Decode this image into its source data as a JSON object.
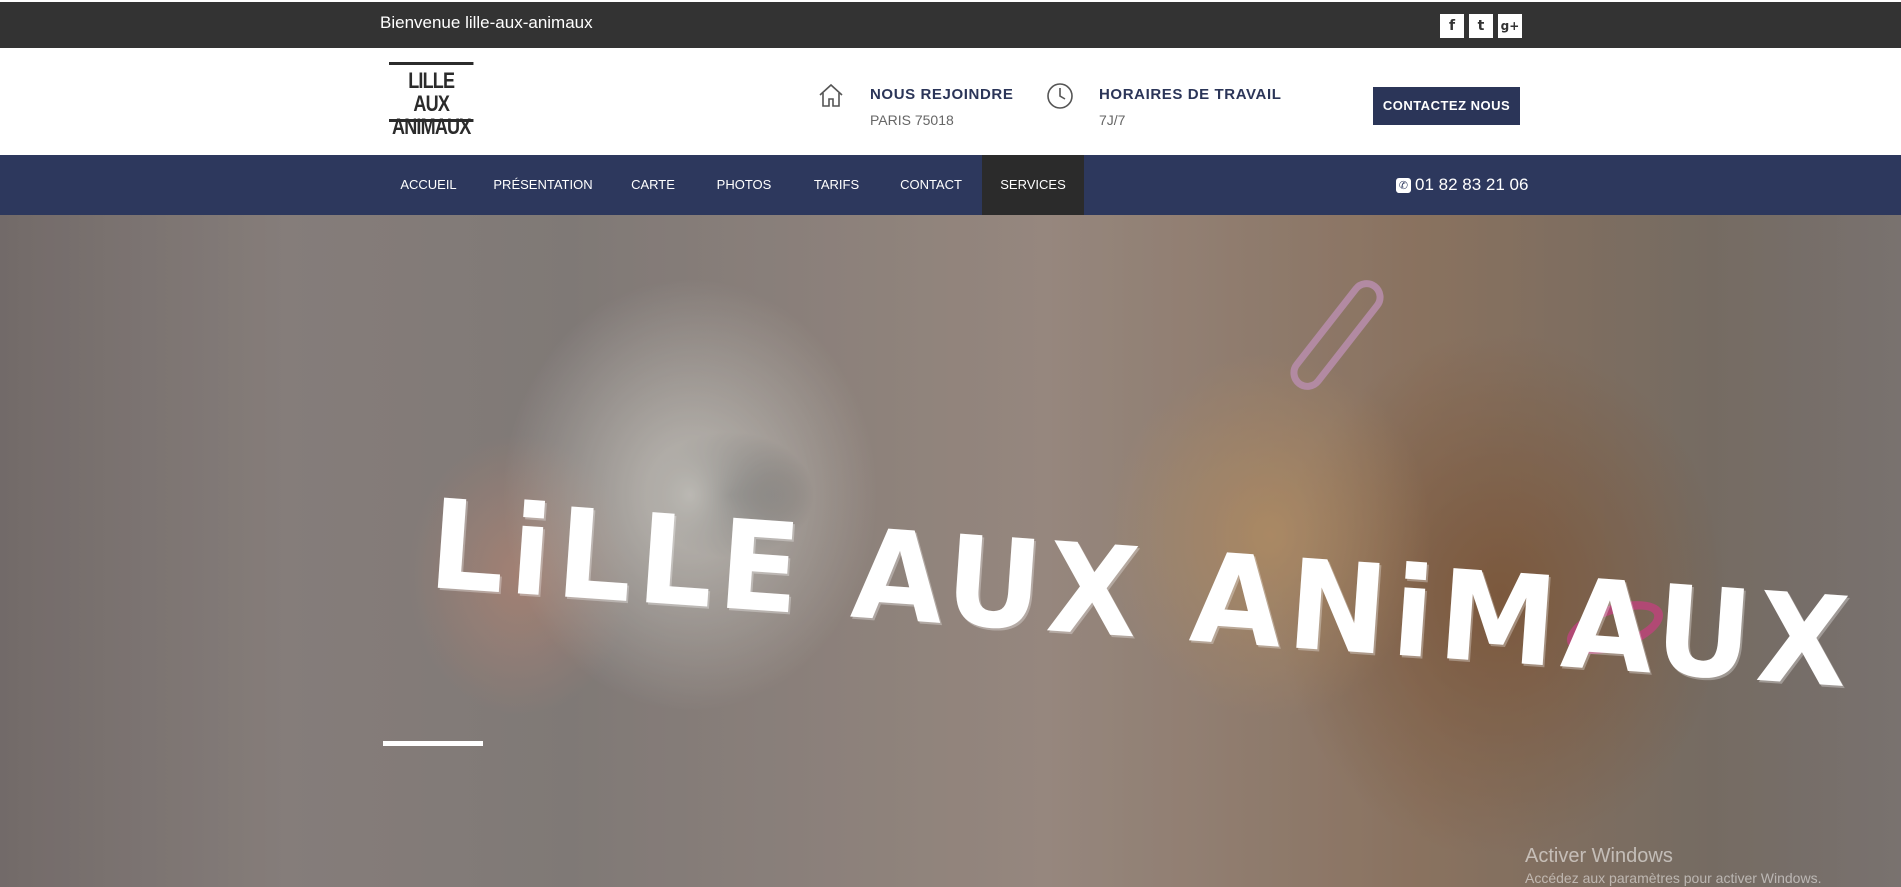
{
  "topbar": {
    "welcome": "Bienvenue lille-aux-animaux",
    "social": [
      {
        "icon": "facebook-icon",
        "glyph": "f"
      },
      {
        "icon": "twitter-icon",
        "glyph": "t"
      },
      {
        "icon": "google-plus-icon",
        "glyph": "g+"
      }
    ]
  },
  "header": {
    "logo_line1": "LILLE AUX",
    "logo_line2": "ANIMAUX",
    "location": {
      "icon": "home-icon",
      "title": "NOUS REJOINDRE",
      "sub": "PARIS 75018"
    },
    "hours": {
      "icon": "clock-icon",
      "title": "HORAIRES DE TRAVAIL",
      "sub": "7J/7"
    },
    "contact_button": "CONTACTEZ NOUS"
  },
  "nav": {
    "items": [
      {
        "label": "ACCUEIL"
      },
      {
        "label": "PRÉSENTATION"
      },
      {
        "label": "CARTE"
      },
      {
        "label": "PHOTOS"
      },
      {
        "label": "TARIFS"
      },
      {
        "label": "CONTACT"
      },
      {
        "label": "SERVICES",
        "active": true
      }
    ],
    "phone_icon": "phone-icon",
    "phone": "01 82 83 21 06"
  },
  "hero": {
    "title": "LiLLE AUX ANiMAUX"
  },
  "windows_watermark": {
    "line1": "Activer Windows",
    "line2": "Accédez aux paramètres pour activer Windows."
  },
  "colors": {
    "topbar": "#333333",
    "navy": "#2d385d",
    "active_nav": "#2b2b2b"
  }
}
